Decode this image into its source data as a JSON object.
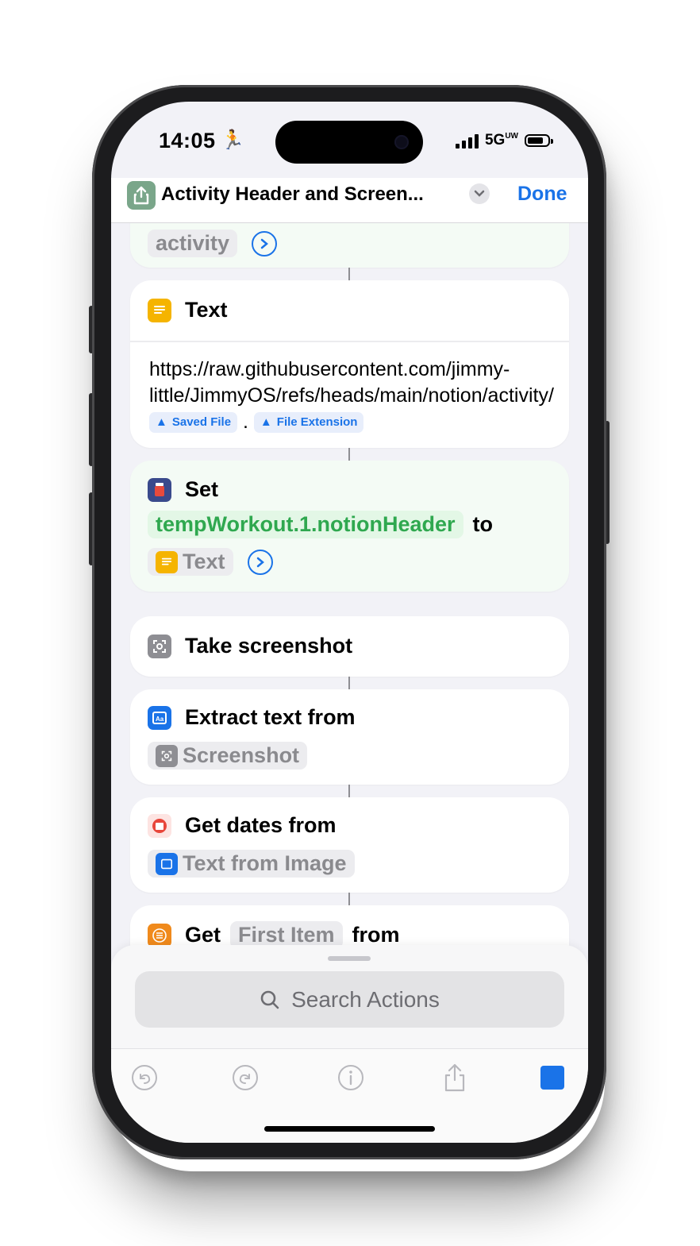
{
  "status_bar": {
    "time": "14:05",
    "activity_glyph": "🏃",
    "network": "5G",
    "network_sub": "UW"
  },
  "nav": {
    "title": "Activity Header and Screen...",
    "done_label": "Done",
    "app_icon": "share-icon"
  },
  "actions": {
    "top_partial": {
      "token": "activity"
    },
    "text_action": {
      "title": "Text",
      "url_text": "https://raw.githubusercontent.com/jimmy-little/JimmyOS/refs/heads/main/notion/activity/",
      "saved_file": "Saved File",
      "dot": ".",
      "file_extension": "File Extension"
    },
    "set_action": {
      "title": "Set",
      "variable": "tempWorkout.1.notionHeader",
      "to_label": "to",
      "value_token": "Text"
    },
    "screenshot_action": {
      "title": "Take screenshot"
    },
    "extract_action": {
      "title": "Extract text from",
      "input_token": "Screenshot"
    },
    "dates_action": {
      "title": "Get dates from",
      "input_token": "Text from Image"
    },
    "get_item_action": {
      "title": "Get",
      "item_token": "First Item",
      "from_label": "from"
    }
  },
  "search": {
    "placeholder": "Search Actions"
  },
  "colors": {
    "accent": "#1a73e8",
    "variable_green": "#2fa84f",
    "text_icon": "#f5b400",
    "dates_icon": "#e8463b",
    "list_icon": "#f08a1c"
  }
}
